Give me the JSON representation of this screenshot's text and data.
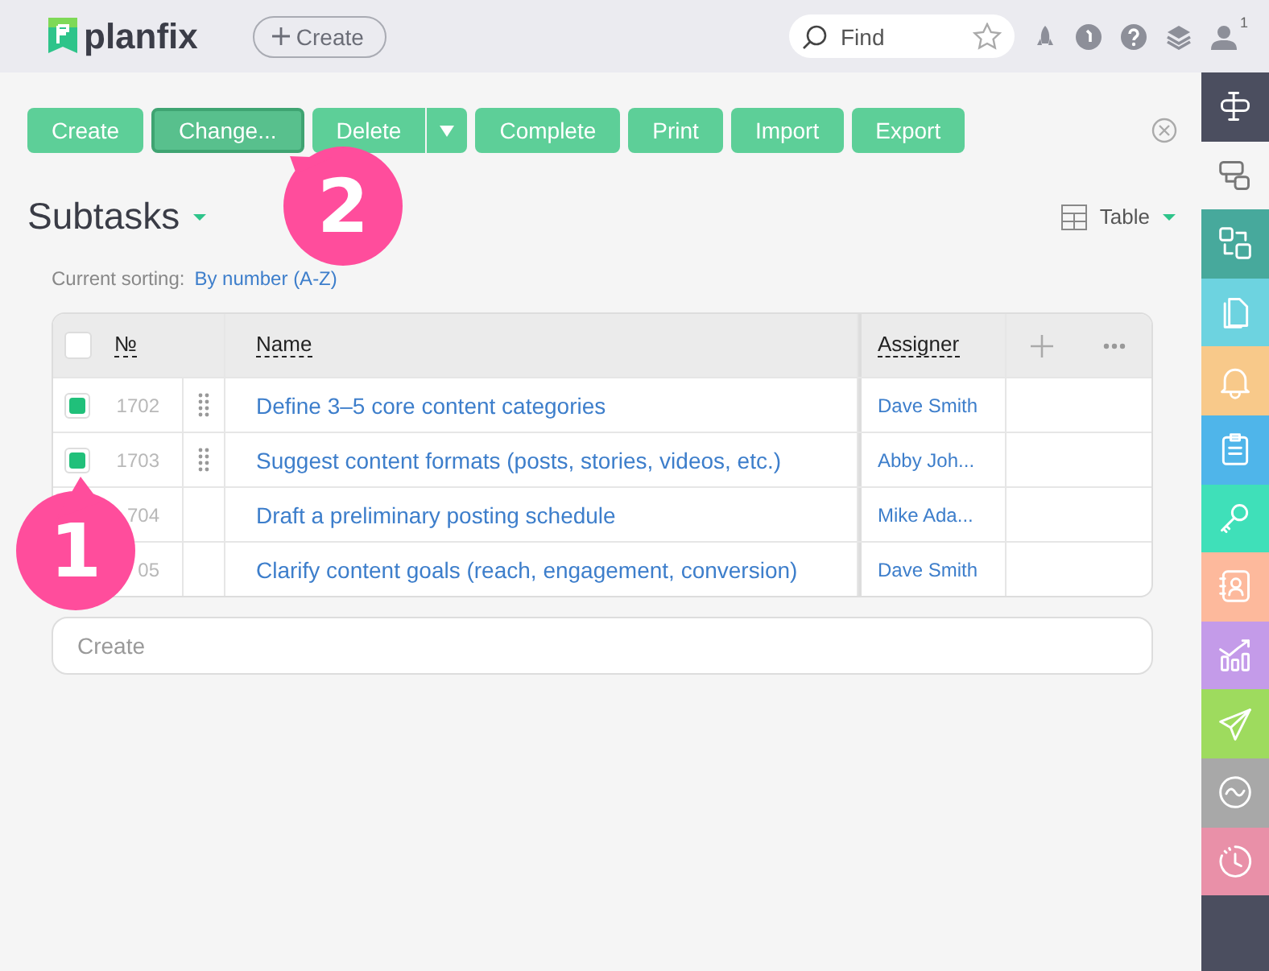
{
  "topbar": {
    "logo": "planfix",
    "create_label": "Create",
    "search": {
      "placeholder": "Find"
    },
    "user_count": "1"
  },
  "toolbar": {
    "buttons": [
      {
        "label": "Create",
        "selected": false,
        "kind": "plain"
      },
      {
        "label": "Change...",
        "selected": true,
        "kind": "plain"
      },
      {
        "label": "Delete",
        "selected": false,
        "kind": "split"
      },
      {
        "label": "Complete",
        "selected": false,
        "kind": "plain"
      },
      {
        "label": "Print",
        "selected": false,
        "kind": "plain"
      },
      {
        "label": "Import",
        "selected": false,
        "kind": "plain"
      },
      {
        "label": "Export",
        "selected": false,
        "kind": "plain"
      }
    ]
  },
  "title": "Subtasks",
  "view": "Table",
  "sorting": {
    "label": "Current sorting:",
    "value": "By number (A-Z)"
  },
  "table": {
    "columns": [
      "№",
      "Name",
      "Assigner"
    ],
    "rows": [
      {
        "number": "1702",
        "name": "Define 3–5 core content categories",
        "assigner": "Dave Smith",
        "checked": true
      },
      {
        "number": "1703",
        "name": "Suggest content formats (posts, stories, videos, etc.)",
        "assigner": "Abby Joh...",
        "checked": true
      },
      {
        "number": "704",
        "name": "Draft a preliminary posting schedule",
        "assigner": "Mike Ada..."
      },
      {
        "number": "05",
        "name": "Clarify content goals (reach, engagement, conversion)",
        "assigner": "Dave Smith"
      }
    ],
    "select_all_checked": false,
    "create_field": {
      "placeholder": "Create"
    }
  },
  "callouts": [
    {
      "label": "1"
    },
    {
      "label": "2"
    }
  ],
  "sidebar": {
    "items": [
      {
        "color": "#4b4e5f",
        "selected": false
      },
      {
        "color": "#f5f5f5",
        "selected": true
      },
      {
        "color": "#47a99c",
        "selected": false
      },
      {
        "color": "#6dd3e0",
        "selected": false
      },
      {
        "color": "#f8c98a",
        "selected": false
      },
      {
        "color": "#4fb5ea",
        "selected": false
      },
      {
        "color": "#3fe0b9",
        "selected": false
      },
      {
        "color": "#fdb99c",
        "selected": false
      },
      {
        "color": "#c49be9",
        "selected": false
      },
      {
        "color": "#9edb5e",
        "selected": false
      },
      {
        "color": "#a8a8a8",
        "selected": false
      },
      {
        "color": "#e990a8",
        "selected": false
      }
    ]
  }
}
